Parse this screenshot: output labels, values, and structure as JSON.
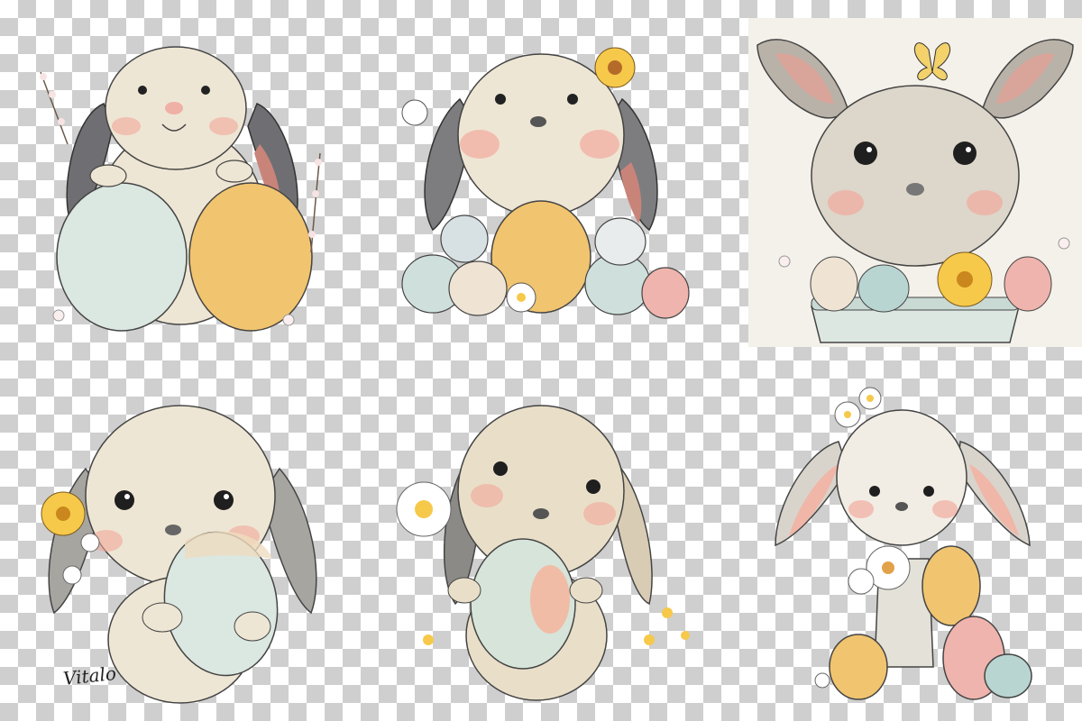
{
  "image": {
    "signature": "Vitalo"
  },
  "palette": {
    "fur": "#eee6d4",
    "fur_shadow": "#d9cdb4",
    "grey_ear": "#7d7d80",
    "inner_ear": "#e9b3a8",
    "blush": "#f2a69a",
    "egg_mint": "#dbe7e1",
    "egg_yellow": "#f1c46f",
    "egg_pink": "#efb4ad",
    "flower_yellow": "#f6c94a",
    "outline": "#3b3b3b"
  }
}
